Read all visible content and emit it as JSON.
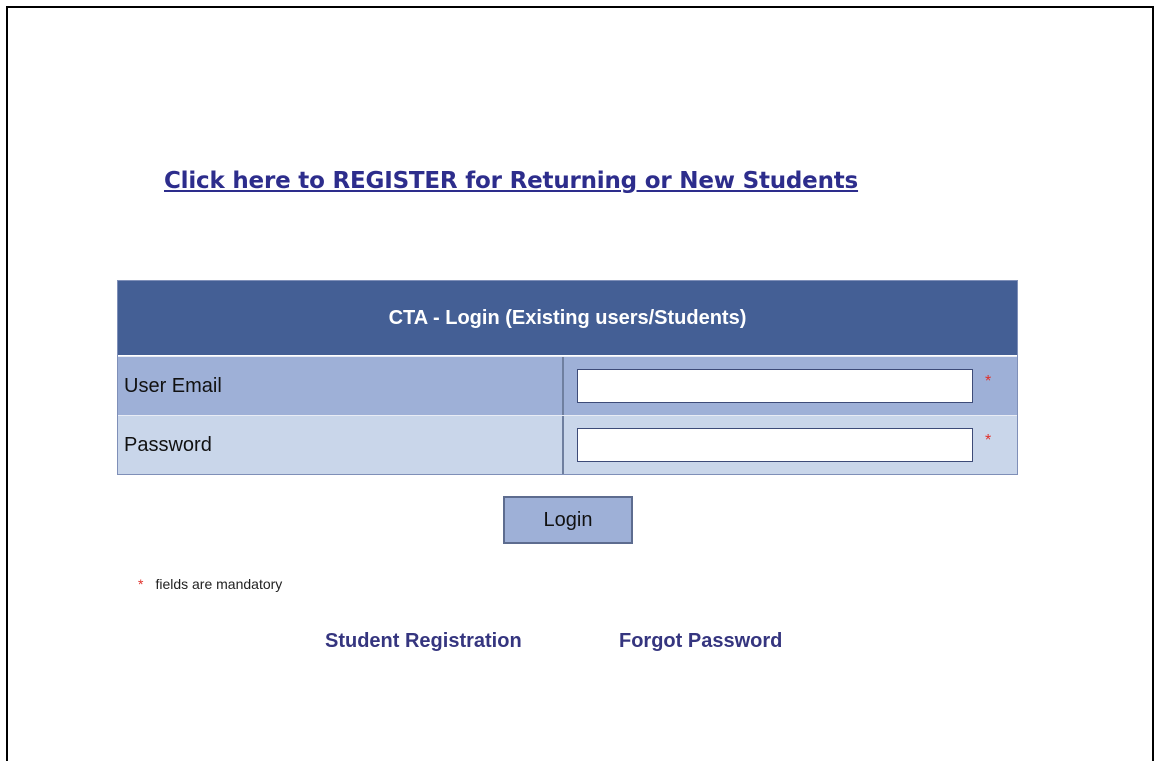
{
  "register_link": "Click here to REGISTER for Returning or New Students",
  "login": {
    "title": "CTA - Login (Existing users/Students)",
    "fields": [
      {
        "label": "User Email",
        "value": "",
        "required_mark": "*"
      },
      {
        "label": "Password",
        "value": "",
        "required_mark": "*"
      }
    ],
    "button_label": "Login"
  },
  "mandatory_note": {
    "mark": "*",
    "text": "fields are mandatory"
  },
  "links": {
    "student_registration": "Student Registration",
    "forgot_password": "Forgot Password"
  },
  "colors": {
    "header_bg": "#445f95",
    "row1_bg": "#9eb0d7",
    "row2_bg": "#c9d6ea",
    "link_color": "#2d2d8c",
    "required_mark": "#e0302a"
  }
}
